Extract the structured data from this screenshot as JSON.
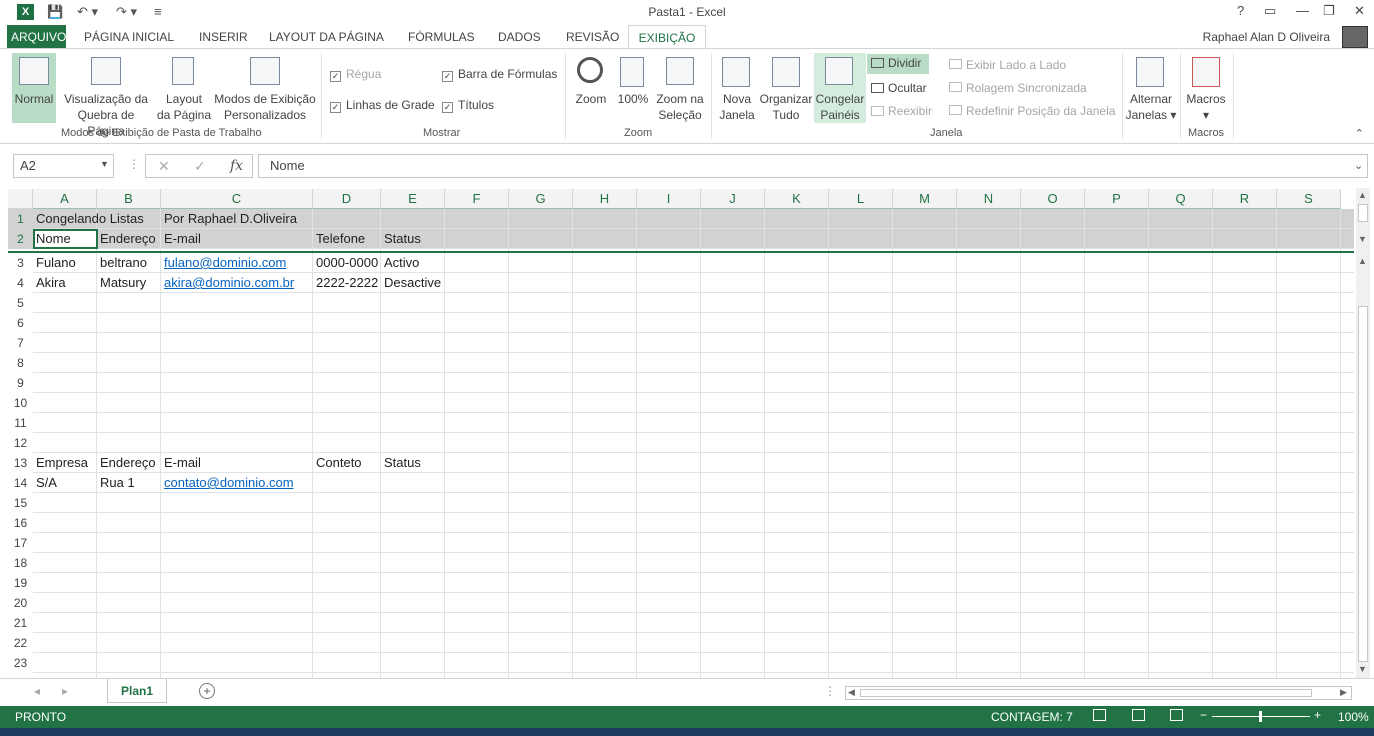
{
  "title_bar": {
    "window_title": "Pasta1 - Excel",
    "help": "?",
    "minimize": "—",
    "restore": "❐",
    "close": "✕"
  },
  "tabs": [
    "ARQUIVO",
    "PÁGINA INICIAL",
    "INSERIR",
    "LAYOUT DA PÁGINA",
    "FÓRMULAS",
    "DADOS",
    "REVISÃO",
    "EXIBIÇÃO"
  ],
  "user": "Raphael Alan D Oliveira",
  "ribbon": {
    "modos": {
      "normal": "Normal",
      "quebra1": "Visualização da",
      "quebra2": "Quebra de Página",
      "layout1": "Layout",
      "layout2": "da Página",
      "pers1": "Modos de Exibição",
      "pers2": "Personalizados",
      "label": "Modos de Exibição de Pasta de Trabalho"
    },
    "mostrar": {
      "regua": "Régua",
      "barra": "Barra de Fórmulas",
      "linhas": "Linhas de Grade",
      "titulos": "Títulos",
      "label": "Mostrar"
    },
    "zoom": {
      "zoom": "Zoom",
      "cem": "100%",
      "sel1": "Zoom na",
      "sel2": "Seleção",
      "label": "Zoom"
    },
    "janela": {
      "nova1": "Nova",
      "nova2": "Janela",
      "org1": "Organizar",
      "org2": "Tudo",
      "cong1": "Congelar",
      "cong2": "Painéis",
      "dividir": "Dividir",
      "ocultar": "Ocultar",
      "reexibir": "Reexibir",
      "lado": "Exibir Lado a Lado",
      "rolagem": "Rolagem Sincronizada",
      "redefinir": "Redefinir Posição da Janela",
      "alt1": "Alternar",
      "alt2": "Janelas",
      "label": "Janela"
    },
    "macros": {
      "macros": "Macros",
      "label": "Macros"
    }
  },
  "formula": {
    "name_box": "A2",
    "fx": "fx",
    "value": "Nome"
  },
  "columns": [
    "A",
    "B",
    "C",
    "D",
    "E",
    "F",
    "G",
    "H",
    "I",
    "J",
    "K",
    "L",
    "M",
    "N",
    "O",
    "P",
    "Q",
    "R",
    "S"
  ],
  "rows": [
    "1",
    "2",
    "3",
    "4",
    "5",
    "6",
    "7",
    "8",
    "9",
    "10",
    "11",
    "12",
    "13",
    "14",
    "15",
    "16",
    "17",
    "18",
    "19",
    "20",
    "21",
    "22",
    "23"
  ],
  "cells": {
    "r1": [
      "Congelando Listas",
      "",
      "Por Raphael D.Oliveira"
    ],
    "r2": [
      "Nome",
      "Endereço",
      "E-mail",
      "Telefone",
      "Status"
    ],
    "r3": [
      "Fulano",
      "beltrano",
      "fulano@dominio.com",
      "0000-0000",
      "Activo"
    ],
    "r4": [
      "Akira",
      "Matsury",
      "akira@dominio.com.br",
      "2222-2222",
      "Desactive"
    ],
    "r13": [
      "Empresa",
      "Endereço",
      "E-mail",
      "Conteto",
      "Status"
    ],
    "r14": [
      "S/A",
      "Rua 1",
      "contato@dominio.com"
    ]
  },
  "sheet_tab": "Plan1",
  "status": {
    "mode": "PRONTO",
    "count": "CONTAGEM: 7",
    "zoom": "100%"
  }
}
